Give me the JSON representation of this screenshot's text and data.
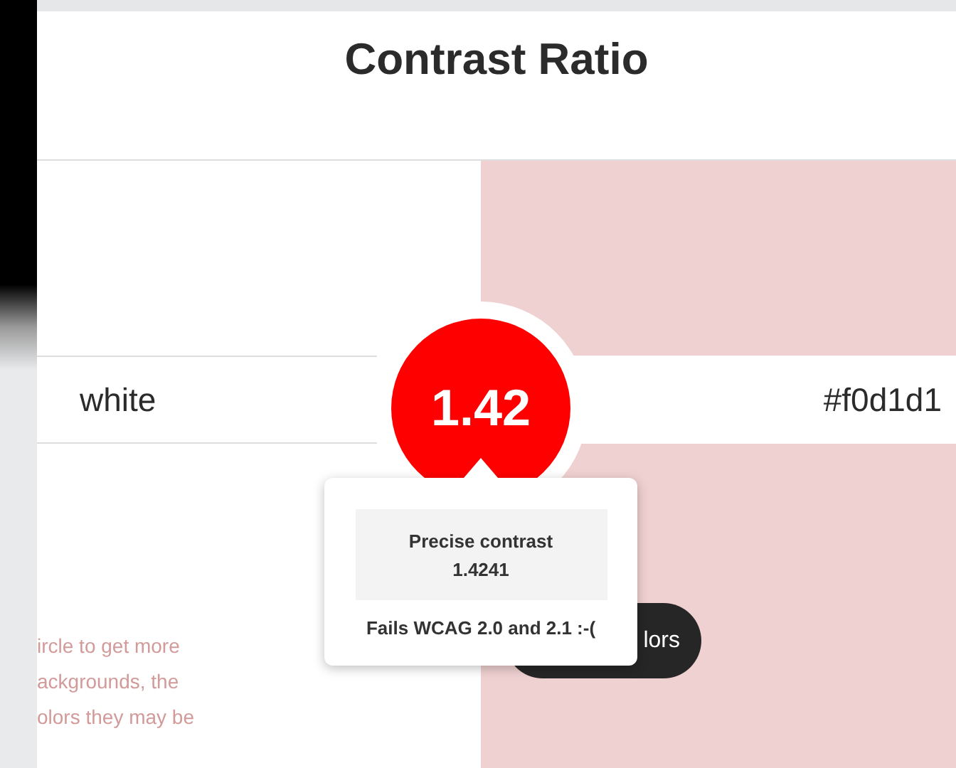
{
  "title": "Contrast Ratio",
  "background_field": {
    "value": "white"
  },
  "foreground_field": {
    "value": "#f0d1d1",
    "color": "#f0d1d1"
  },
  "ratio": {
    "value": "1.42",
    "color": "#ff0000"
  },
  "tooltip": {
    "label": "Precise contrast",
    "value": "1.4241",
    "verdict": "Fails WCAG 2.0 and 2.1 :-("
  },
  "hint_lines": [
    "ircle to get more",
    "ackgrounds, the",
    "olors they may be"
  ],
  "button": {
    "label": "lors"
  }
}
